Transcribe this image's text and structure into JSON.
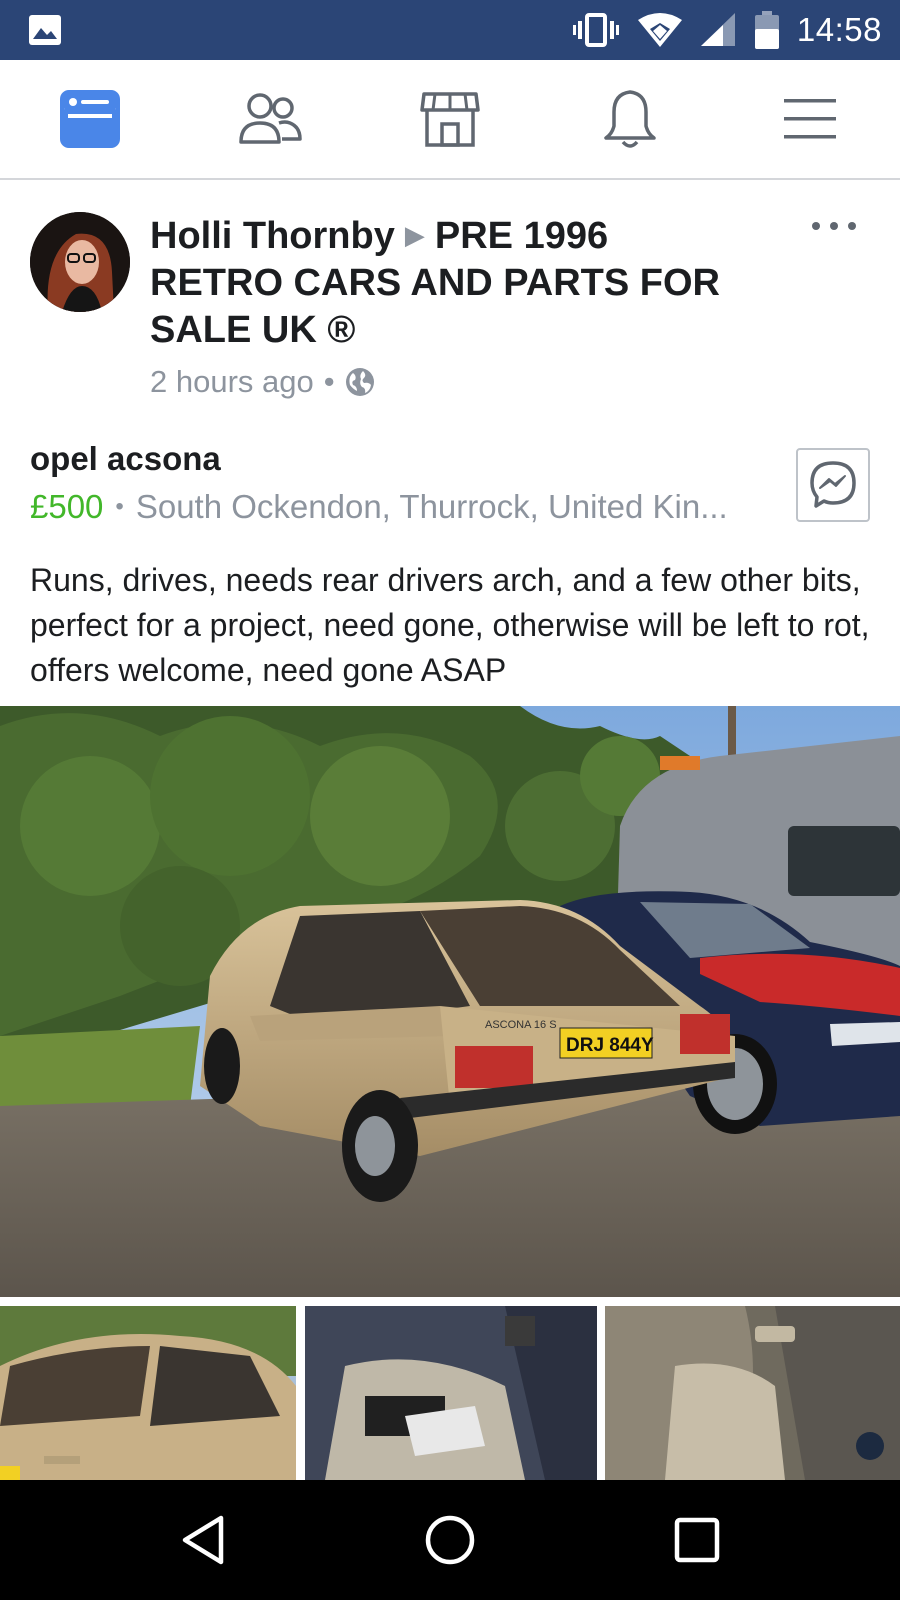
{
  "status_bar": {
    "time": "14:58",
    "icons": [
      "image-icon",
      "vibrate-icon",
      "wifi-icon",
      "signal-icon",
      "battery-icon"
    ]
  },
  "nav_tabs": [
    {
      "name": "news-feed",
      "icon": "news-feed-icon",
      "active": true
    },
    {
      "name": "friends",
      "icon": "friends-icon",
      "active": false
    },
    {
      "name": "marketplace",
      "icon": "marketplace-icon",
      "active": false
    },
    {
      "name": "notifications",
      "icon": "bell-icon",
      "active": false
    },
    {
      "name": "menu",
      "icon": "hamburger-menu-icon",
      "active": false
    }
  ],
  "post": {
    "author": "Holli Thornby",
    "group": "PRE 1996 RETRO CARS AND PARTS FOR SALE UK ®",
    "time_ago": "2 hours ago",
    "separator": "•",
    "privacy_icon": "globe-icon"
  },
  "listing": {
    "title": "opel acsona",
    "price": "£500",
    "location": "South Ockendon, Thurrock, United Kin...",
    "description": "Runs, drives, needs rear drivers arch, and a few other bits, perfect for a project, need gone, otherwise will be left to rot, offers welcome, need gone ASAP"
  },
  "photos": {
    "main_plate": "DRJ 844Y",
    "main_badge": "ASCONA 16 S"
  },
  "colors": {
    "status_bar": "#2b4576",
    "active_tab": "#4a86e8",
    "inactive_tab": "#606770",
    "price": "#42b72a",
    "muted": "#8d949e"
  }
}
